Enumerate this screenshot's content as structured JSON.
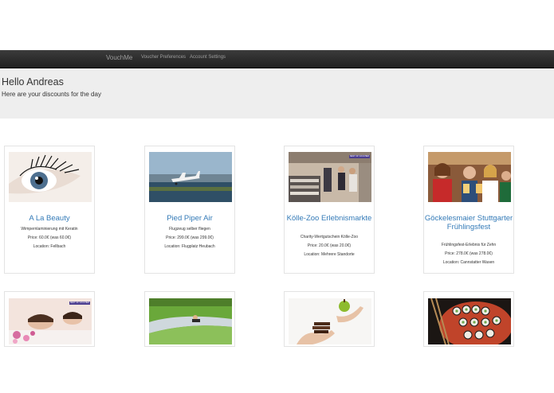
{
  "navbar": {
    "brand": "VouchMe",
    "links": [
      "Voucher Preferences",
      "Account Settings"
    ]
  },
  "header": {
    "greeting": "Hello Andreas",
    "subtitle": "Here are your discounts for the day"
  },
  "vouchers": [
    {
      "title": "A La Beauty",
      "description": "Wimpernlaminierung mit Keratin",
      "price": "Price: 60.0€ (was 60.0€)",
      "location": "Location: Fellbach"
    },
    {
      "title": "Pied Piper Air",
      "description": "Flugzeug selber fliegen",
      "price": "Price: 299.0€ (was 299.0€)",
      "location": "Location: Flugplatz Heubach"
    },
    {
      "title": "Kölle-Zoo Erlebnismarkte",
      "description": "Charity-Wertgutschein Kölle-Zoo",
      "price": "Price: 20.0€ (was 20.0€)",
      "location": "Location: Mehrere Standorte"
    },
    {
      "title": "Göckelesmaier Stuttgarter Frühlingsfest",
      "description": "Frühlingsfest-Erlebnis für Zehn",
      "price": "Price: 278.0€ (was 278.0€)",
      "location": "Location: Cannstatter Wasen"
    }
  ],
  "colors": {
    "navbar": "#222222",
    "jumbotron": "#eeeeee",
    "link": "#337ab7"
  }
}
